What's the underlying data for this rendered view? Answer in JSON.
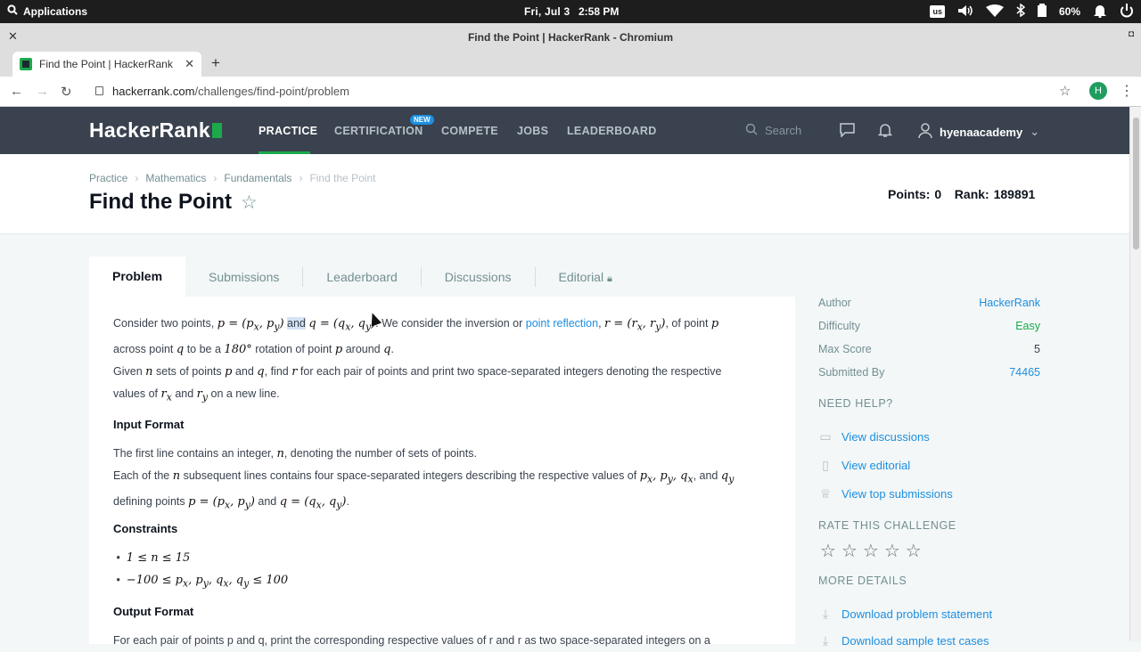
{
  "os": {
    "apps_label": "Applications",
    "date": "Fri, Jul  3",
    "time": "2:58 PM",
    "kbd": "us",
    "battery": "60%"
  },
  "window": {
    "title": "Find the Point | HackerRank - Chromium"
  },
  "browser": {
    "tab_title": "Find the Point | HackerRank",
    "url_host": "hackerrank.com",
    "url_path": "/challenges/find-point/problem",
    "profile_initial": "H"
  },
  "nav": {
    "logo": "HackerRank",
    "links": [
      "PRACTICE",
      "CERTIFICATION",
      "COMPETE",
      "JOBS",
      "LEADERBOARD"
    ],
    "new_badge": "NEW",
    "search_placeholder": "Search",
    "username": "hyenaacademy"
  },
  "breadcrumb": [
    "Practice",
    "Mathematics",
    "Fundamentals",
    "Find the Point"
  ],
  "page": {
    "title": "Find the Point",
    "points_label": "Points: 0",
    "rank_label": "Rank: 189891"
  },
  "tabs": [
    "Problem",
    "Submissions",
    "Leaderboard",
    "Discussions",
    "Editorial"
  ],
  "problem": {
    "p1a": "Consider two points,",
    "p1_math1": "p = (p",
    "p1_and": "and",
    "p1_math2": "q = (q",
    "p1b": ". We consider the inversion or",
    "p1_link": "point reflection",
    "p1c": ", of point",
    "p1d": "across point",
    "p1e": "to be a",
    "p1f": "rotation of point",
    "p1g": "around",
    "p2a": "Given",
    "p2b": "sets of points",
    "p2c": "and",
    "p2d": ", find",
    "p2e": "for each pair of points and print two space-separated integers denoting the respective",
    "p2f": "values of",
    "p2g": "and",
    "p2h": "on a new line.",
    "input_heading": "Input Format",
    "in1a": "The first line contains an integer,",
    "in1b": ", denoting the number of sets of points.",
    "in2a": "Each of the",
    "in2b": "subsequent lines contains four space-separated integers describing the respective values of",
    "in2c": ", and",
    "in2d": "defining points",
    "in2e": "and",
    "constraints_heading": "Constraints",
    "c1": "1 ≤ n ≤ 15",
    "c2": "−100 ≤ p",
    "output_heading": "Output Format",
    "out1": "For each pair of points p and q, print the corresponding respective values of r and r as two space-separated integers on a"
  },
  "sidebar": {
    "author_k": "Author",
    "author_v": "HackerRank",
    "difficulty_k": "Difficulty",
    "difficulty_v": "Easy",
    "maxscore_k": "Max Score",
    "maxscore_v": "5",
    "submitted_k": "Submitted By",
    "submitted_v": "74465",
    "need_help": "NEED HELP?",
    "help_links": [
      "View discussions",
      "View editorial",
      "View top submissions"
    ],
    "rate": "RATE THIS CHALLENGE",
    "rating": 0,
    "more": "MORE DETAILS",
    "download": "Download problem statement",
    "download2": "Download sample test cases"
  },
  "colors": {
    "brand_green": "#1ba94c",
    "nav_bg": "#39424e",
    "link_blue": "#1d8fe1",
    "easy_green": "#1ba94c"
  }
}
